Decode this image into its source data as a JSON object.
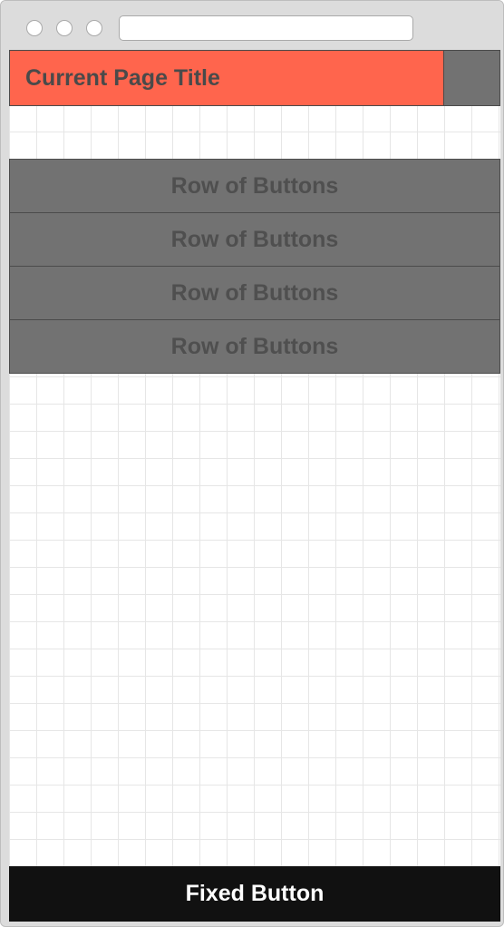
{
  "browser": {
    "traffic_lights": [
      "close",
      "minimize",
      "maximize"
    ],
    "url": ""
  },
  "header": {
    "title": "Current Page Title"
  },
  "rows": [
    {
      "label": "Row of Buttons"
    },
    {
      "label": "Row of Buttons"
    },
    {
      "label": "Row of Buttons"
    },
    {
      "label": "Row of Buttons"
    }
  ],
  "fixed_button": {
    "label": "Fixed Button"
  },
  "colors": {
    "header_bg": "#ff654d",
    "row_bg": "#727272",
    "fixed_bg": "#111111",
    "chrome_bg": "#dcdcdc"
  }
}
